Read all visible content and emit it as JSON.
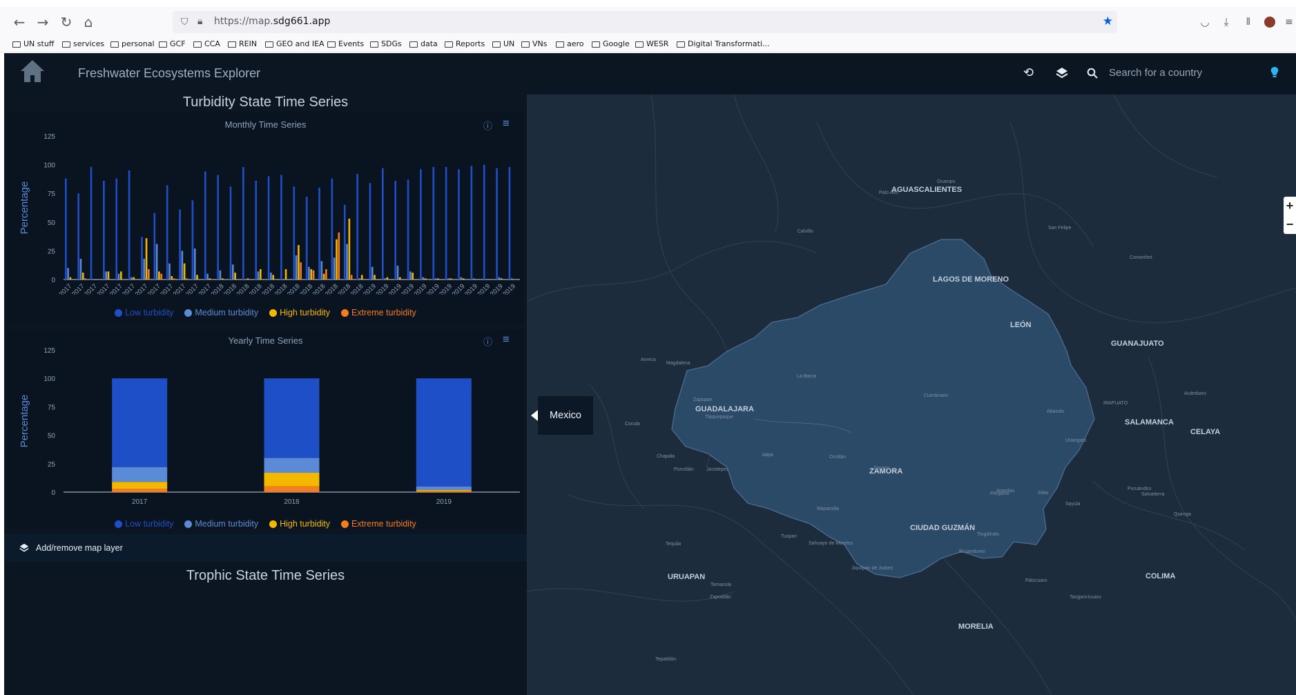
{
  "browser": {
    "url_prefix": "https://map.",
    "url_domain": "sdg661.app",
    "bookmarks": [
      "UN stuff",
      "services",
      "personal",
      "GCF",
      "CCA",
      "REIN",
      "GEO and IEA",
      "Events",
      "SDGs",
      "data",
      "Reports",
      "UN",
      "VNs",
      "aero",
      "Google",
      "WESR",
      "Digital Transformati..."
    ]
  },
  "app": {
    "title": "Freshwater Ecosystems Explorer",
    "search_placeholder": "Search for a country"
  },
  "turbidity": {
    "section_title": "Turbidity State Time Series",
    "monthly_title": "Monthly Time Series",
    "yearly_title": "Yearly Time Series",
    "legend": [
      "Low turbidity",
      "Medium turbidity",
      "High turbidity",
      "Extreme turbidity"
    ]
  },
  "add_layer_label": "Add/remove map layer",
  "trophic_title": "Trophic State Time Series",
  "map": {
    "tooltip": "Mexico",
    "labels": [
      {
        "t": "AGUASCALIENTES",
        "big": true
      },
      {
        "t": "LAGOS DE MORENO",
        "big": true
      },
      {
        "t": "LEÓN",
        "big": true
      },
      {
        "t": "GUANAJUATO",
        "big": true
      },
      {
        "t": "IRAPUATO",
        "big": false
      },
      {
        "t": "SALAMANCA",
        "big": true
      },
      {
        "t": "CELAYA",
        "big": true
      },
      {
        "t": "Zapopan",
        "big": false
      },
      {
        "t": "GUADALAJARA",
        "big": true
      },
      {
        "t": "Tlaquepaque",
        "big": false
      },
      {
        "t": "Ocotlán",
        "big": false
      },
      {
        "t": "ZAMORA",
        "big": true
      },
      {
        "t": "CIUDAD GUZMÁN",
        "big": true
      },
      {
        "t": "URUAPAN",
        "big": true
      },
      {
        "t": "MORELIA",
        "big": true
      },
      {
        "t": "COLIMA",
        "big": true
      },
      {
        "t": "Tepatitlán",
        "big": false
      },
      {
        "t": "La Barca",
        "big": false
      },
      {
        "t": "Zacapu",
        "big": false
      },
      {
        "t": "Ecuandureo",
        "big": false
      },
      {
        "t": "Pénjamo",
        "big": false
      },
      {
        "t": "Silao",
        "big": false
      },
      {
        "t": "Arandas",
        "big": false
      },
      {
        "t": "Cuerámaro",
        "big": false
      },
      {
        "t": "Abasolo",
        "big": false
      },
      {
        "t": "Uriangato",
        "big": false
      },
      {
        "t": "Salvatierra",
        "big": false
      },
      {
        "t": "Puruándiro",
        "big": false
      },
      {
        "t": "Sayula",
        "big": false
      },
      {
        "t": "Tequila",
        "big": false
      },
      {
        "t": "Magdalena",
        "big": false
      },
      {
        "t": "Ameca",
        "big": false
      },
      {
        "t": "Cocula",
        "big": false
      },
      {
        "t": "Chapala",
        "big": false
      },
      {
        "t": "Jocotepec",
        "big": false
      },
      {
        "t": "Poncitlán",
        "big": false
      },
      {
        "t": "Jalpa",
        "big": false
      },
      {
        "t": "Calvillo",
        "big": false
      },
      {
        "t": "Palo Alto",
        "big": false
      },
      {
        "t": "Ocampo",
        "big": false
      },
      {
        "t": "San Felipe",
        "big": false
      },
      {
        "t": "Comonfort",
        "big": false
      },
      {
        "t": "Acámbaro",
        "big": false
      },
      {
        "t": "Quiroga",
        "big": false
      },
      {
        "t": "Pátzcuaro",
        "big": false
      },
      {
        "t": "Tangancícuaro",
        "big": false
      },
      {
        "t": "Tingüindin",
        "big": false
      },
      {
        "t": "Jiquilpan de Juárez",
        "big": false
      },
      {
        "t": "Sahuayo de Morelos",
        "big": false
      },
      {
        "t": "Mazamitla",
        "big": false
      },
      {
        "t": "Tuxpan",
        "big": false
      },
      {
        "t": "Zapotitlán",
        "big": false
      },
      {
        "t": "Tamazula",
        "big": false
      }
    ]
  },
  "chart_data": [
    {
      "type": "bar",
      "title": "Monthly Time Series",
      "ylabel": "Percentage",
      "ylim": [
        0,
        125
      ],
      "yticks": [
        0,
        25,
        50,
        75,
        100,
        125
      ],
      "categories": [
        "Jan 2017",
        "Feb 2017",
        "Mar 2017",
        "Apr 2017",
        "May 2017",
        "Jun 2017",
        "Jul 2017",
        "Aug 2017",
        "Sep 2017",
        "Oct 2017",
        "Nov 2017",
        "Dec 2017",
        "Jan 2018",
        "Feb 2018",
        "Mar 2018",
        "Apr 2018",
        "May 2018",
        "Jun 2018",
        "Jul 2018",
        "Aug 2018",
        "Sep 2018",
        "Oct 2018",
        "Nov 2018",
        "Dec 2018",
        "Jan 2019",
        "Feb 2019",
        "Mar 2019",
        "Apr 2019",
        "May 2019",
        "Jun 2019",
        "Jul 2019",
        "Aug 2019",
        "Sep 2019",
        "Oct 2019",
        "Nov 2019",
        "Dec 2019"
      ],
      "series": [
        {
          "name": "Low turbidity",
          "color": "#1f4fc6",
          "values": [
            88,
            75,
            98,
            86,
            88,
            95,
            37,
            58,
            82,
            61,
            69,
            94,
            91,
            81,
            98,
            86,
            90,
            91,
            81,
            72,
            80,
            88,
            65,
            92,
            84,
            97,
            86,
            87,
            96,
            98,
            98,
            96,
            99,
            100,
            97,
            98
          ]
        },
        {
          "name": "Medium turbidity",
          "color": "#5b8ad6",
          "values": [
            10,
            18,
            0,
            7,
            5,
            2,
            18,
            31,
            14,
            25,
            27,
            5,
            8,
            13,
            0,
            7,
            6,
            0,
            21,
            11,
            16,
            19,
            31,
            1,
            11,
            1,
            12,
            7,
            2,
            1,
            1,
            2,
            1,
            0,
            2,
            1
          ]
        },
        {
          "name": "High turbidity",
          "color": "#f5b800",
          "values": [
            2,
            6,
            0,
            7,
            7,
            2,
            36,
            7,
            3,
            14,
            4,
            1,
            1,
            6,
            1,
            9,
            4,
            9,
            30,
            9,
            5,
            35,
            53,
            4,
            4,
            2,
            2,
            6,
            1,
            1,
            1,
            1,
            0,
            0,
            1,
            0
          ]
        },
        {
          "name": "Extreme turbidity",
          "color": "#f57c1f",
          "values": [
            0,
            1,
            0,
            0,
            0,
            0,
            9,
            5,
            1,
            1,
            0,
            0,
            0,
            0,
            0,
            0,
            0,
            0,
            15,
            8,
            9,
            41,
            4,
            0,
            0,
            0,
            0,
            0,
            0,
            0,
            0,
            0,
            0,
            0,
            0,
            0
          ]
        }
      ]
    },
    {
      "type": "bar",
      "title": "Yearly Time Series",
      "ylabel": "Percentage",
      "ylim": [
        0,
        125
      ],
      "yticks": [
        0,
        25,
        50,
        75,
        100,
        125
      ],
      "stacked": true,
      "categories": [
        "2017",
        "2018",
        "2019"
      ],
      "series": [
        {
          "name": "Low turbidity",
          "color": "#1f4fc6",
          "values": [
            78,
            70,
            95
          ]
        },
        {
          "name": "Medium turbidity",
          "color": "#5b8ad6",
          "values": [
            13,
            13,
            3
          ]
        },
        {
          "name": "High turbidity",
          "color": "#f5b800",
          "values": [
            6,
            12,
            1
          ]
        },
        {
          "name": "Extreme turbidity",
          "color": "#f57c1f",
          "values": [
            3,
            5,
            1
          ]
        }
      ]
    }
  ]
}
